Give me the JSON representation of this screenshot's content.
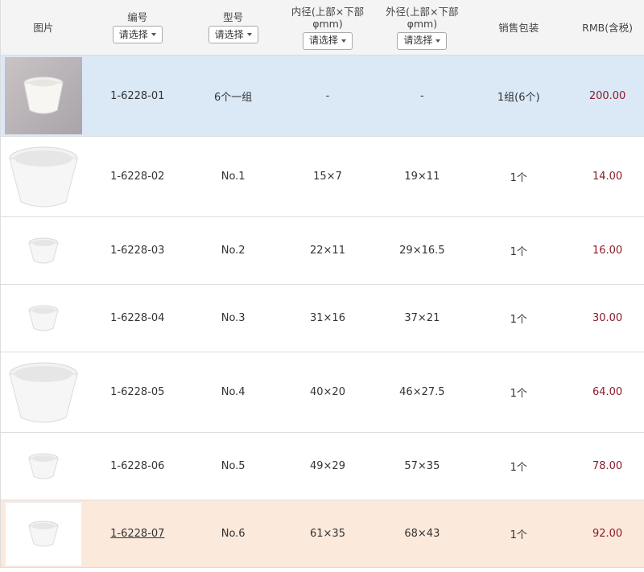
{
  "headers": {
    "image": "图片",
    "number": "编号",
    "type": "型号",
    "inner": [
      "内径(上部×下部",
      "φmm)"
    ],
    "outer": [
      "外径(上部×下部",
      "φmm)"
    ],
    "pack": "销售包装",
    "price": "RMB(含税)",
    "select_label": "请选择"
  },
  "rows": [
    {
      "num": "1-6228-01",
      "type": "6个一组",
      "inner": "-",
      "outer": "-",
      "pack": "1组(6个)",
      "price": "200.00"
    },
    {
      "num": "1-6228-02",
      "type": "No.1",
      "inner": "15×7",
      "outer": "19×11",
      "pack": "1个",
      "price": "14.00"
    },
    {
      "num": "1-6228-03",
      "type": "No.2",
      "inner": "22×11",
      "outer": "29×16.5",
      "pack": "1个",
      "price": "16.00"
    },
    {
      "num": "1-6228-04",
      "type": "No.3",
      "inner": "31×16",
      "outer": "37×21",
      "pack": "1个",
      "price": "30.00"
    },
    {
      "num": "1-6228-05",
      "type": "No.4",
      "inner": "40×20",
      "outer": "46×27.5",
      "pack": "1个",
      "price": "64.00"
    },
    {
      "num": "1-6228-06",
      "type": "No.5",
      "inner": "49×29",
      "outer": "57×35",
      "pack": "1个",
      "price": "78.00"
    },
    {
      "num": "1-6228-07",
      "type": "No.6",
      "inner": "61×35",
      "outer": "68×43",
      "pack": "1个",
      "price": "92.00"
    }
  ],
  "colors": {
    "selected_row": "#dbe8f6",
    "hover_row": "#fbe9dc",
    "price": "#8a1c2b"
  }
}
